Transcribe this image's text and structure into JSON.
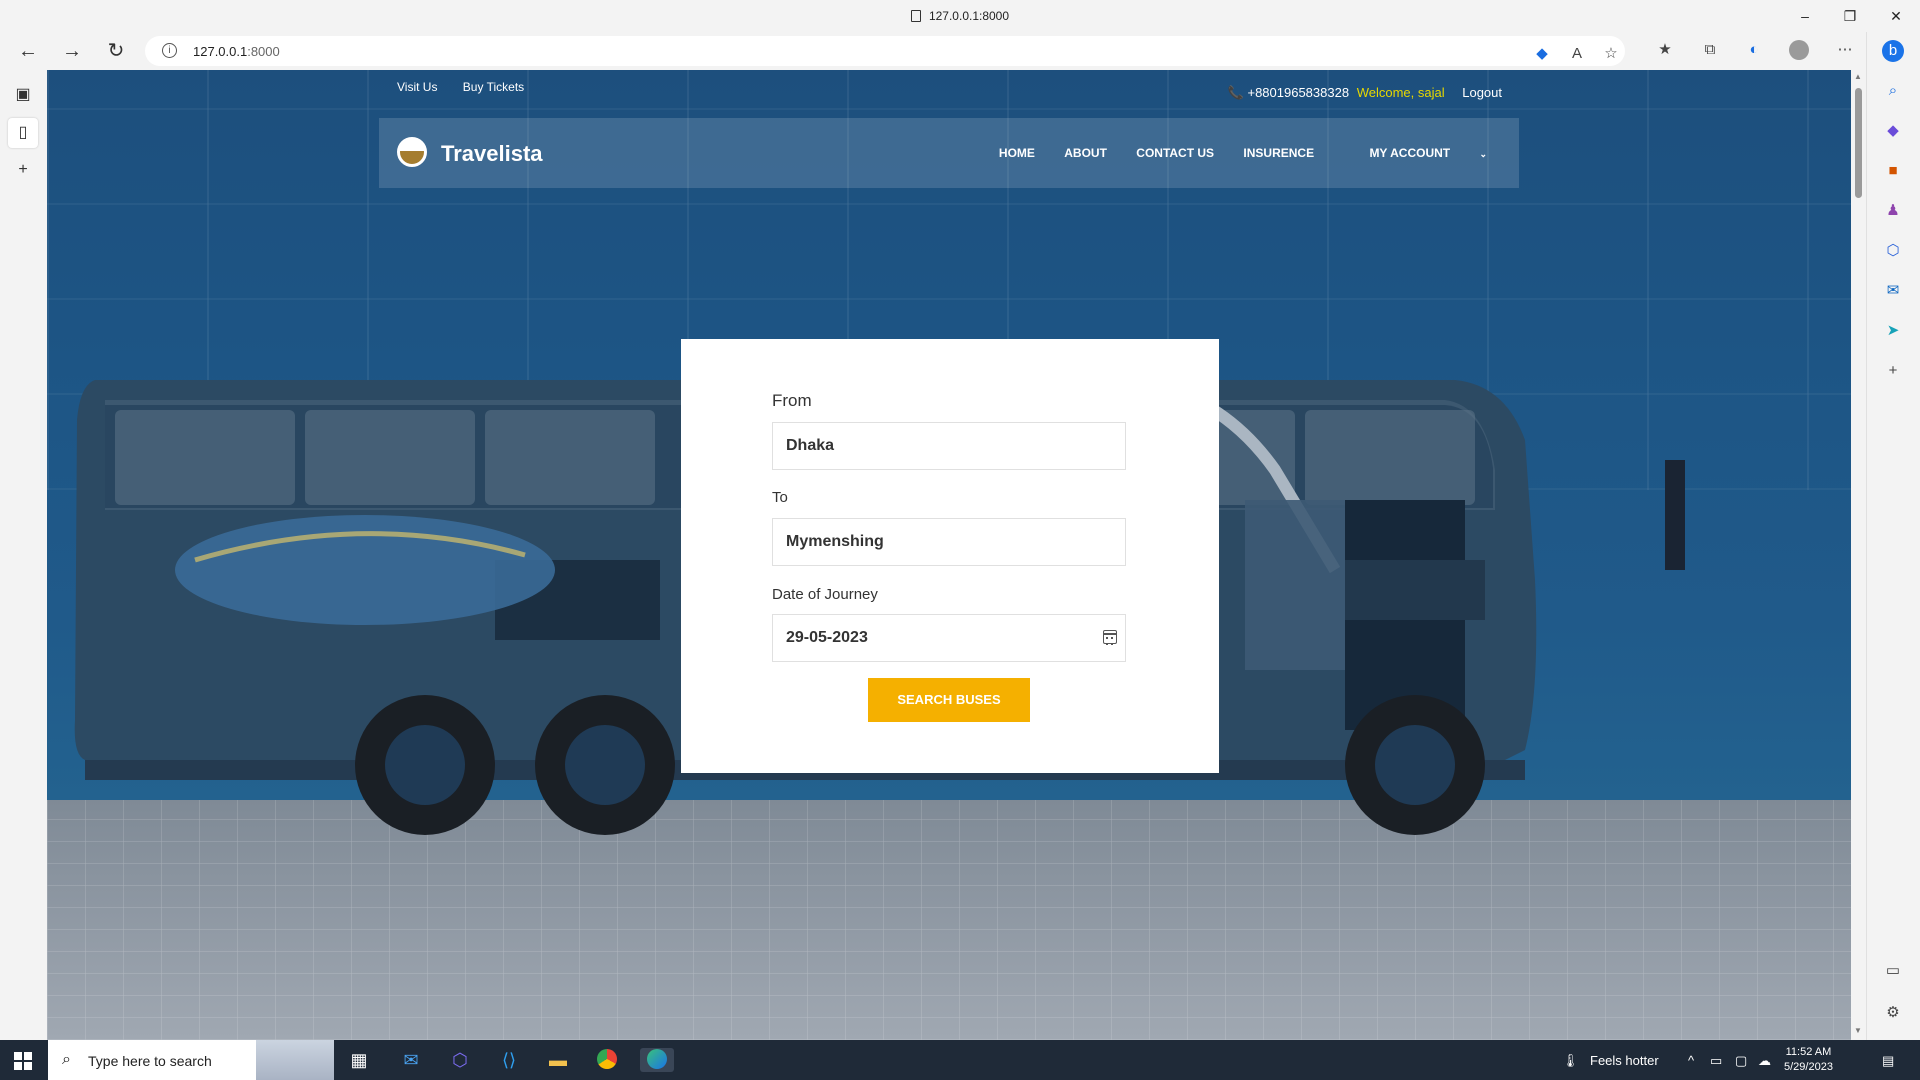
{
  "browser": {
    "window_title": "127.0.0.1:8000",
    "url_host": "127.0.0.1",
    "url_port": ":8000"
  },
  "site": {
    "topbar": {
      "links": [
        "Visit Us",
        "Buy Tickets"
      ],
      "phone": "+8801965838328",
      "welcome": "Welcome, sajal",
      "logout": "Logout"
    },
    "brand": "Travelista",
    "menu": [
      "HOME",
      "ABOUT",
      "CONTACT US",
      "INSURENCE",
      "MY ACCOUNT"
    ]
  },
  "search_form": {
    "from_label": "From",
    "from_value": "Dhaka",
    "to_label": "To",
    "to_value": "Mymenshing",
    "date_label": "Date of Journey",
    "date_value": "29-05-2023",
    "button": "SEARCH BUSES"
  },
  "taskbar": {
    "search_placeholder": "Type here to search",
    "weather": "Feels hotter",
    "time": "11:52 AM",
    "date": "5/29/2023"
  },
  "colors": {
    "accent": "#f5b000",
    "welcome": "#e6d800",
    "hero_blue": "#1d5585"
  }
}
